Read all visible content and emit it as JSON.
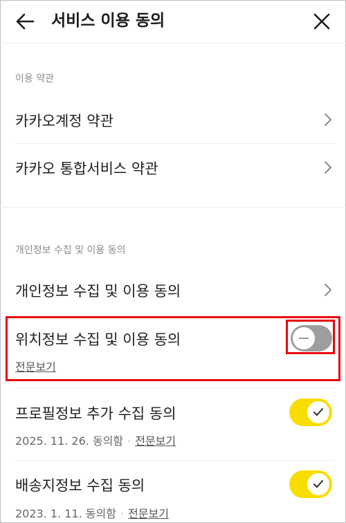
{
  "header": {
    "title": "서비스 이용 동의"
  },
  "sections": {
    "terms": {
      "label": "이용 약관",
      "items": [
        {
          "label": "카카오계정 약관"
        },
        {
          "label": "카카오 통합서비스 약관"
        }
      ]
    },
    "privacy": {
      "label": "개인정보 수집 및 이용 동의",
      "items": [
        {
          "label": "개인정보 수집 및 이용 동의"
        },
        {
          "label": "위치정보 수집 및 이용 동의",
          "link": "전문보기",
          "toggle_on": false
        },
        {
          "label": "프로필정보 추가 수집 동의",
          "date": "2025. 11. 26. 동의함",
          "separator": "·",
          "link": "전문보기",
          "toggle_on": true
        },
        {
          "label": "배송지정보 수집 동의",
          "date": "2023. 1. 11. 동의함",
          "separator": "·",
          "link": "전문보기",
          "toggle_on": true
        }
      ]
    }
  },
  "colors": {
    "toggle_on": "#f7dd00",
    "toggle_off": "#9e9e9e",
    "highlight": "#e8000b"
  }
}
